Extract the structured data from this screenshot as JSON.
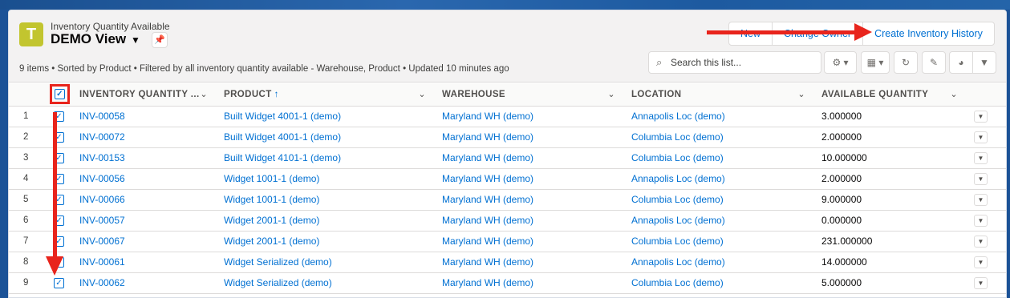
{
  "header": {
    "object_label": "Inventory Quantity Available",
    "view_title": "DEMO View",
    "summary": "9 items • Sorted by Product • Filtered by all inventory quantity available - Warehouse, Product • Updated 10 minutes ago"
  },
  "actions": {
    "new_label": "New",
    "change_owner_label": "Change Owner",
    "create_history_label": "Create Inventory History"
  },
  "search": {
    "placeholder": "Search this list..."
  },
  "table": {
    "columns": [
      "INVENTORY QUANTITY ...",
      "PRODUCT",
      "WAREHOUSE",
      "LOCATION",
      "AVAILABLE QUANTITY"
    ],
    "rows": [
      {
        "num": "1",
        "inv": "INV-00058",
        "product": "Built Widget 4001-1 (demo)",
        "warehouse": "Maryland WH (demo)",
        "location": "Annapolis Loc (demo)",
        "qty": "3.000000"
      },
      {
        "num": "2",
        "inv": "INV-00072",
        "product": "Built Widget 4001-1 (demo)",
        "warehouse": "Maryland WH (demo)",
        "location": "Columbia Loc (demo)",
        "qty": "2.000000"
      },
      {
        "num": "3",
        "inv": "INV-00153",
        "product": "Built Widget 4101-1 (demo)",
        "warehouse": "Maryland WH (demo)",
        "location": "Columbia Loc (demo)",
        "qty": "10.000000"
      },
      {
        "num": "4",
        "inv": "INV-00056",
        "product": "Widget 1001-1 (demo)",
        "warehouse": "Maryland WH (demo)",
        "location": "Annapolis Loc (demo)",
        "qty": "2.000000"
      },
      {
        "num": "5",
        "inv": "INV-00066",
        "product": "Widget 1001-1 (demo)",
        "warehouse": "Maryland WH (demo)",
        "location": "Columbia Loc (demo)",
        "qty": "9.000000"
      },
      {
        "num": "6",
        "inv": "INV-00057",
        "product": "Widget 2001-1 (demo)",
        "warehouse": "Maryland WH (demo)",
        "location": "Annapolis Loc (demo)",
        "qty": "0.000000"
      },
      {
        "num": "7",
        "inv": "INV-00067",
        "product": "Widget 2001-1 (demo)",
        "warehouse": "Maryland WH (demo)",
        "location": "Columbia Loc (demo)",
        "qty": "231.000000"
      },
      {
        "num": "8",
        "inv": "INV-00061",
        "product": "Widget Serialized (demo)",
        "warehouse": "Maryland WH (demo)",
        "location": "Annapolis Loc (demo)",
        "qty": "14.000000"
      },
      {
        "num": "9",
        "inv": "INV-00062",
        "product": "Widget Serialized (demo)",
        "warehouse": "Maryland WH (demo)",
        "location": "Columbia Loc (demo)",
        "qty": "5.000000"
      }
    ]
  },
  "colors": {
    "link": "#0070d2",
    "annotation": "#e8241c",
    "object_icon": "#c2c52f"
  }
}
